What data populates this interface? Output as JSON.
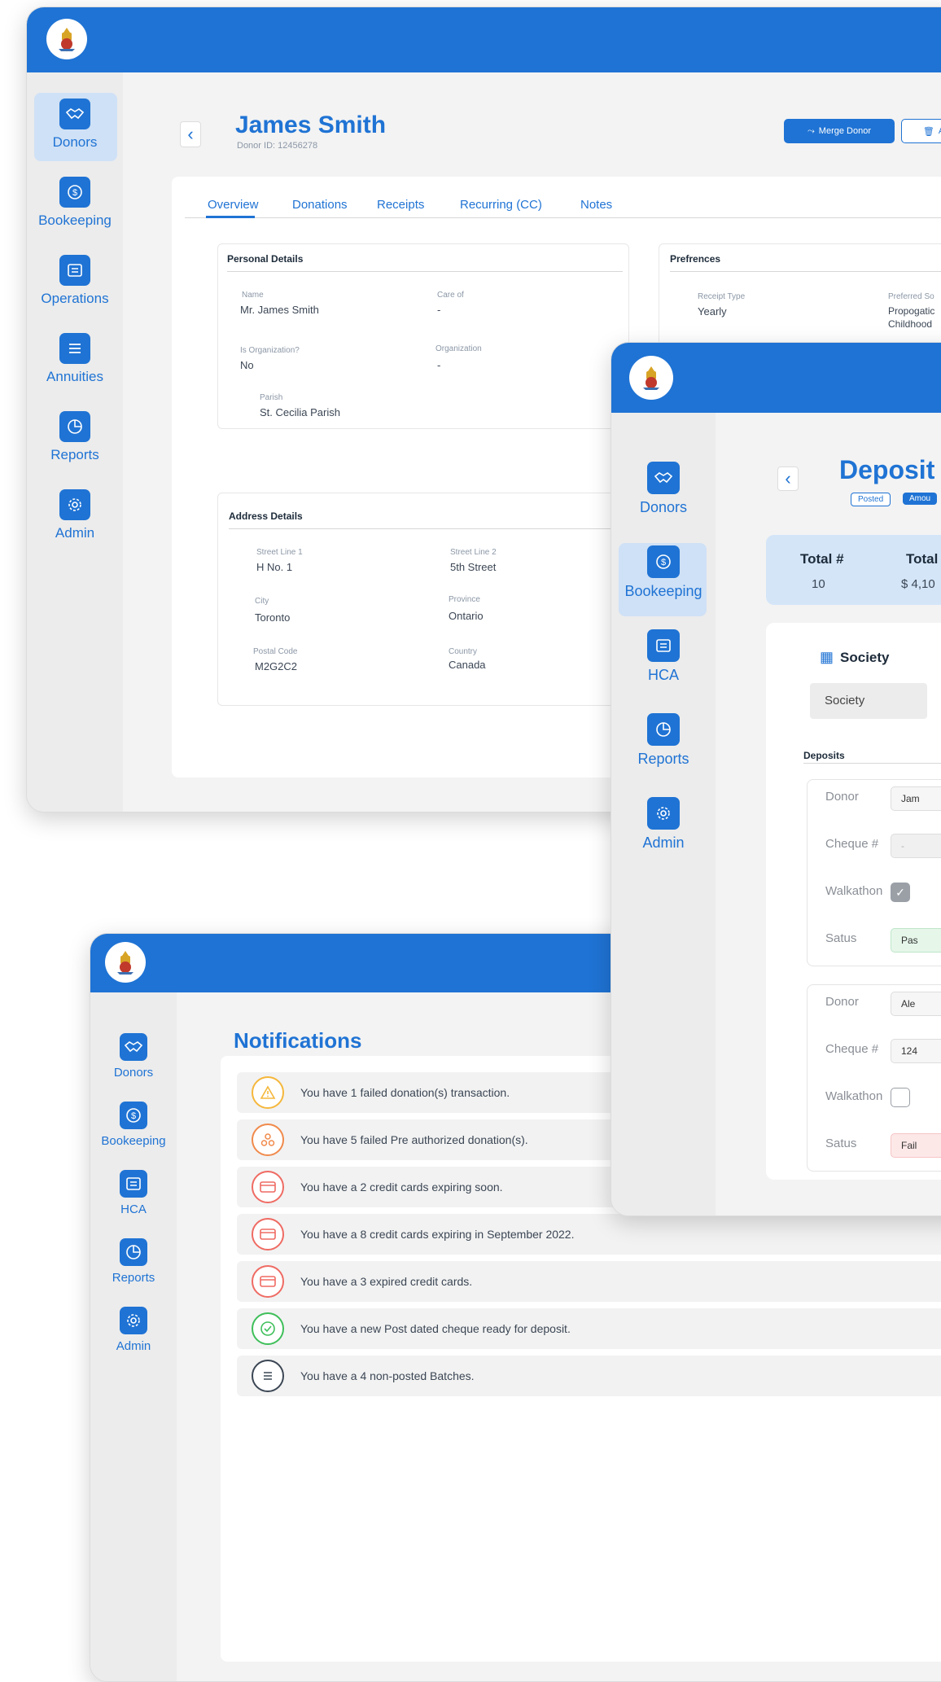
{
  "donor_window": {
    "sidebar": [
      {
        "label": "Donors",
        "icon": "handshake-icon"
      },
      {
        "label": "Bookeeping",
        "icon": "dollar-icon"
      },
      {
        "label": "Operations",
        "icon": "document-icon"
      },
      {
        "label": "Annuities",
        "icon": "list-icon"
      },
      {
        "label": "Reports",
        "icon": "pie-chart-icon"
      },
      {
        "label": "Admin",
        "icon": "gear-icon"
      }
    ],
    "back": "‹",
    "title": "James Smith",
    "donor_id": "Donor ID: 12456278",
    "merge_button": "Merge Donor",
    "second_button": "A",
    "tabs": [
      "Overview",
      "Donations",
      "Receipts",
      "Recurring (CC)",
      "Notes"
    ],
    "personal": {
      "heading": "Personal Details",
      "name_label": "Name",
      "name_value": "Mr.  James Smith",
      "careof_label": "Care of",
      "careof_value": "-",
      "isorg_label": "Is Organization?",
      "isorg_value": "No",
      "org_label": "Organization",
      "org_value": "-",
      "parish_label": "Parish",
      "parish_value": "St. Cecilia Parish"
    },
    "address": {
      "heading": "Address Details",
      "street1_label": "Street Line 1",
      "street1_value": "H No. 1",
      "street2_label": "Street Line 2",
      "street2_value": "5th Street",
      "city_label": "City",
      "city_value": "Toronto",
      "province_label": "Province",
      "province_value": "Ontario",
      "postal_label": "Postal Code",
      "postal_value": "M2G2C2",
      "country_label": "Country",
      "country_value": "Canada"
    },
    "preferences": {
      "heading": "Prefrences",
      "receipt_label": "Receipt Type",
      "receipt_value": "Yearly",
      "society_label": "Preferred So",
      "society_value1": "Propogatic",
      "society_value2": "Childhood"
    }
  },
  "deposit_window": {
    "sidebar": [
      {
        "label": "Donors",
        "icon": "handshake-icon"
      },
      {
        "label": "Bookeeping",
        "icon": "dollar-icon"
      },
      {
        "label": "HCA",
        "icon": "document-icon"
      },
      {
        "label": "Reports",
        "icon": "pie-chart-icon"
      },
      {
        "label": "Admin",
        "icon": "gear-icon"
      }
    ],
    "back": "‹",
    "title": "Deposit",
    "badge_posted": "Posted",
    "badge_amount": "Amou",
    "total_count_label": "Total #",
    "total_count_value": "10",
    "total_amount_label": "Total",
    "total_amount_value": "$ 4,10",
    "society_heading": "Society",
    "society_field": "Society",
    "deposits_heading": "Deposits",
    "entries": [
      {
        "donor_label": "Donor",
        "donor_value": "Jam",
        "cheque_label": "Cheque #",
        "cheque_value": "-",
        "walk_label": "Walkathon",
        "status_label": "Satus",
        "status_value": "Pas",
        "checked": true
      },
      {
        "donor_label": "Donor",
        "donor_value": "Ale",
        "cheque_label": "Cheque #",
        "cheque_value": "124",
        "walk_label": "Walkathon",
        "status_label": "Satus",
        "status_value": "Fail",
        "checked": false
      }
    ]
  },
  "notifications_window": {
    "sidebar": [
      {
        "label": "Donors",
        "icon": "handshake-icon"
      },
      {
        "label": "Bookeeping",
        "icon": "dollar-icon"
      },
      {
        "label": "HCA",
        "icon": "document-icon"
      },
      {
        "label": "Reports",
        "icon": "pie-chart-icon"
      },
      {
        "label": "Admin",
        "icon": "gear-icon"
      }
    ],
    "title": "Notifications",
    "items": [
      {
        "text": "You have 1 failed donation(s) transaction.",
        "icon": "warning-icon",
        "color": "#f5b73b"
      },
      {
        "text": "You have 5 failed Pre authorized donation(s).",
        "icon": "group-icon",
        "color": "#f08a4b"
      },
      {
        "text": "You have a 2 credit cards expiring soon.",
        "icon": "credit-card-icon",
        "color": "#ef6b63"
      },
      {
        "text": "You have a 8 credit cards expiring in September 2022.",
        "icon": "credit-card-icon",
        "color": "#ef6b63"
      },
      {
        "text": "You have a 3 expired credit cards.",
        "icon": "credit-card-icon",
        "color": "#ef6b63"
      },
      {
        "text": "You have a new Post dated cheque ready for deposit.",
        "icon": "check-circle-icon",
        "color": "#3fbf5a"
      },
      {
        "text": "You have a 4 non-posted Batches.",
        "icon": "list-icon",
        "color": "#3b4654"
      }
    ]
  }
}
